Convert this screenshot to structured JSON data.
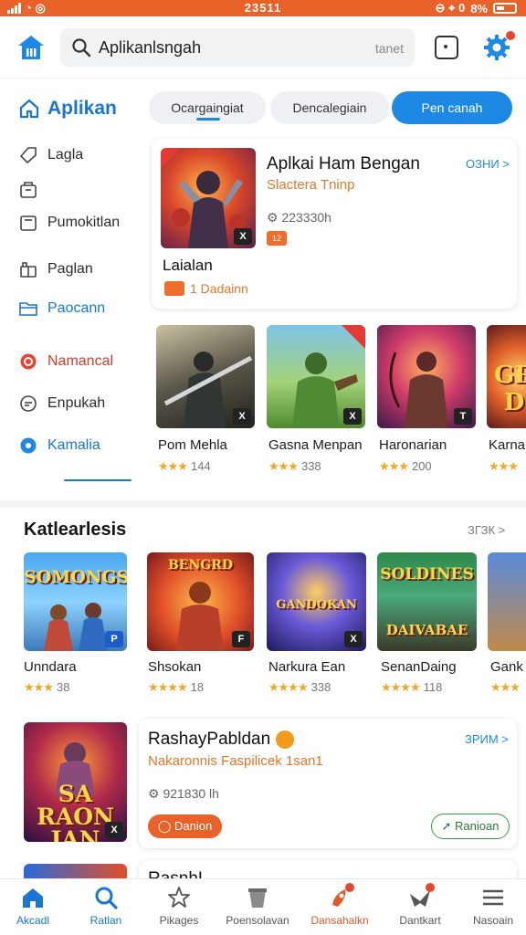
{
  "status_bar": {
    "time": "23511",
    "battery": "8%"
  },
  "search": {
    "query": "Aplikanlsngah",
    "right_text": "tanet"
  },
  "sidebar": {
    "header": "Aplikan",
    "items": [
      {
        "label": "Lagla",
        "icon": "tag-icon"
      },
      {
        "label": "",
        "icon": "bag-icon"
      },
      {
        "label": "Pumokitlan",
        "icon": "library-icon"
      },
      {
        "label": "Paglan",
        "icon": "gift-icon"
      },
      {
        "label": "Paocann",
        "icon": "folder-icon"
      },
      {
        "label": "Namancal",
        "icon": "update-icon"
      },
      {
        "label": "Enpukah",
        "icon": "chat-icon"
      },
      {
        "label": "Kamalia",
        "icon": "account-icon"
      }
    ]
  },
  "tabs": [
    "Ocargaingiat",
    "Dencalegiain",
    "Pen canah"
  ],
  "featured": {
    "title": "Aplkai Ham Bengan",
    "subtitle": "Slactera Tninp",
    "size": "223330h",
    "more": "ОЗНИ >",
    "label": "Laialan",
    "badge_text": "1 Dadainn"
  },
  "row1": [
    {
      "name": "Pom Mehla",
      "rating": "144",
      "badge": "X"
    },
    {
      "name": "Gasna Menpan",
      "rating": "338",
      "badge": "X"
    },
    {
      "name": "Haronarian",
      "rating": "200",
      "badge": "T"
    },
    {
      "name": "Karna",
      "rating": "",
      "badge": ""
    }
  ],
  "section": {
    "title": "Katlearlesis",
    "more": "ЗГЗК >"
  },
  "row2": [
    {
      "name": "Unndara",
      "rating": "38",
      "badge": "P",
      "art": "SOMONGS"
    },
    {
      "name": "Shsokan",
      "rating": "18",
      "badge": "F",
      "art": "BENGRD"
    },
    {
      "name": "Narkura Ean",
      "rating": "338",
      "badge": "X",
      "art": "GANDOKAN"
    },
    {
      "name": "SenanDaing",
      "rating": "118",
      "badge": "",
      "art": "SOLDINES"
    },
    {
      "name": "Gank",
      "rating": "",
      "badge": "",
      "art": ""
    }
  ],
  "promo": {
    "title": "RashayPabldan",
    "subtitle": "Nakaronnis Faspilicek 1san1",
    "size": "921830 lh",
    "more": "ЗРИМ >",
    "art": "SA RAON JAN",
    "btn_left": "Danion",
    "btn_right": "Ranioan"
  },
  "partial_next": "RasnhL",
  "bottom_nav": [
    {
      "label": "Akcadl",
      "icon": "home-icon"
    },
    {
      "label": "Ratlan",
      "icon": "search-icon"
    },
    {
      "label": "Pikages",
      "icon": "star-icon"
    },
    {
      "label": "Poensolavan",
      "icon": "bucket-icon"
    },
    {
      "label": "Dansahalkn",
      "icon": "rocket-icon"
    },
    {
      "label": "Dantkart",
      "icon": "bird-icon"
    },
    {
      "label": "Nasoain",
      "icon": "menu-icon"
    }
  ],
  "colors": {
    "accent": "#1e88e5",
    "status_bar": "#e8622a",
    "orange": "#e8762a",
    "star": "#f5a623"
  }
}
